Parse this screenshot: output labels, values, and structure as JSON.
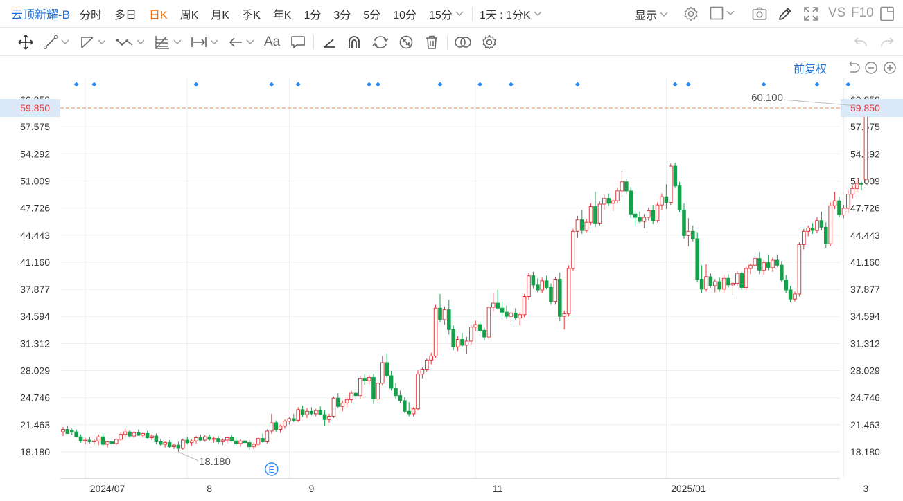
{
  "header": {
    "stock_name": "云顶新耀-B",
    "periods": [
      "分时",
      "多日",
      "日K",
      "周K",
      "月K",
      "季K",
      "年K",
      "1分",
      "3分",
      "5分",
      "10分",
      "15分"
    ],
    "active_period": "日K",
    "range_select": "1天 : 1分K",
    "display_label": "显示",
    "vs_label": "VS",
    "f10_label": "F10"
  },
  "toolbar": {
    "text_tool_label": "Aa",
    "icons": [
      "move-icon",
      "line-icon",
      "channel-icon",
      "polyline-icon",
      "fibonacci-icon",
      "measure-icon",
      "arrow-icon",
      "text-icon",
      "comment-icon",
      "angle-icon",
      "arc-icon",
      "cycle-icon",
      "hide-icon",
      "delete-icon",
      "compare-icon",
      "settings-icon",
      "undo-icon",
      "redo-icon"
    ]
  },
  "chart_controls": {
    "adjust_label": "前复权"
  },
  "colors": {
    "up": "#e0393e",
    "down": "#15a04b",
    "accent": "#1a6fd8",
    "price_line": "#f0874a",
    "current_price_bg": "#dce9f9",
    "current_price_text": "#e0393e",
    "event_marker": "#2d8cf0"
  },
  "chart_data": {
    "type": "candlestick",
    "y_ticks": [
      "60.858",
      "57.575",
      "54.292",
      "51.009",
      "47.726",
      "44.443",
      "41.160",
      "37.877",
      "34.594",
      "31.312",
      "28.029",
      "24.746",
      "21.463",
      "18.180"
    ],
    "ylim": [
      15.6,
      60.858
    ],
    "x_tick_labels": [
      {
        "label": "2024/07",
        "index": 5
      },
      {
        "label": "8",
        "index": 28
      },
      {
        "label": "9",
        "index": 51
      },
      {
        "label": "11",
        "index": 93
      },
      {
        "label": "2025/01",
        "index": 136
      },
      {
        "label": "3",
        "index": 176
      }
    ],
    "current_price": "59.850",
    "max_annotation": {
      "label": "60.100",
      "index": 179,
      "value": 60.1
    },
    "min_annotation": {
      "label": "18.180",
      "index": 26,
      "value": 18.18
    },
    "event_marker_label": "E",
    "event_marker_index": 47,
    "dividend_marker_indices": [
      3,
      7,
      30,
      47,
      53,
      69,
      71,
      85,
      94,
      101,
      116,
      138,
      141,
      158,
      170,
      177
    ],
    "ohlc": [
      [
        20.6,
        21.2,
        20.1,
        20.9
      ],
      [
        20.9,
        21.3,
        20.5,
        20.4
      ],
      [
        20.8,
        21.0,
        20.2,
        20.6
      ],
      [
        20.6,
        20.9,
        19.9,
        20.0
      ],
      [
        20.0,
        20.3,
        19.3,
        19.5
      ],
      [
        19.5,
        19.9,
        19.1,
        19.6
      ],
      [
        19.6,
        20.0,
        19.2,
        19.4
      ],
      [
        19.4,
        19.8,
        19.0,
        19.5
      ],
      [
        19.5,
        20.3,
        19.0,
        20.0
      ],
      [
        20.0,
        20.4,
        18.9,
        19.1
      ],
      [
        19.1,
        19.5,
        18.7,
        19.4
      ],
      [
        19.4,
        19.7,
        18.9,
        19.2
      ],
      [
        19.2,
        19.8,
        19.0,
        19.7
      ],
      [
        19.7,
        20.5,
        19.5,
        20.3
      ],
      [
        20.3,
        21.0,
        20.0,
        20.6
      ],
      [
        20.6,
        20.8,
        19.9,
        20.1
      ],
      [
        20.1,
        20.7,
        19.9,
        20.5
      ],
      [
        20.5,
        20.9,
        20.1,
        20.2
      ],
      [
        20.2,
        20.6,
        19.9,
        20.4
      ],
      [
        20.4,
        20.7,
        19.8,
        19.9
      ],
      [
        19.9,
        20.3,
        19.6,
        20.1
      ],
      [
        20.1,
        20.4,
        19.1,
        19.4
      ],
      [
        19.4,
        19.8,
        18.9,
        19.1
      ],
      [
        19.1,
        19.5,
        18.7,
        19.3
      ],
      [
        19.3,
        19.6,
        18.6,
        18.8
      ],
      [
        18.8,
        19.2,
        18.5,
        19.0
      ],
      [
        19.0,
        19.4,
        18.2,
        18.6
      ],
      [
        18.6,
        19.8,
        18.4,
        19.6
      ],
      [
        19.6,
        20.0,
        19.1,
        19.3
      ],
      [
        19.3,
        19.7,
        18.9,
        19.5
      ],
      [
        19.5,
        20.1,
        19.2,
        19.9
      ],
      [
        19.9,
        20.3,
        19.5,
        19.6
      ],
      [
        19.6,
        20.2,
        19.4,
        20.0
      ],
      [
        20.0,
        20.3,
        19.5,
        19.7
      ],
      [
        19.7,
        20.0,
        19.3,
        19.8
      ],
      [
        19.8,
        20.1,
        19.1,
        19.4
      ],
      [
        19.4,
        19.8,
        19.0,
        19.6
      ],
      [
        19.6,
        20.0,
        19.2,
        19.9
      ],
      [
        19.9,
        20.2,
        19.4,
        19.5
      ],
      [
        19.5,
        19.9,
        18.9,
        19.2
      ],
      [
        19.2,
        19.7,
        18.8,
        19.5
      ],
      [
        19.5,
        19.8,
        19.1,
        19.3
      ],
      [
        19.3,
        19.6,
        18.4,
        18.8
      ],
      [
        18.8,
        19.3,
        18.5,
        19.1
      ],
      [
        19.1,
        19.9,
        18.9,
        19.8
      ],
      [
        19.8,
        20.4,
        19.3,
        19.4
      ],
      [
        19.4,
        20.9,
        19.2,
        20.7
      ],
      [
        20.7,
        22.8,
        20.4,
        21.7
      ],
      [
        21.7,
        22.0,
        20.6,
        20.9
      ],
      [
        20.9,
        21.5,
        20.5,
        21.3
      ],
      [
        21.3,
        22.1,
        21.0,
        21.9
      ],
      [
        21.9,
        22.4,
        21.5,
        22.2
      ],
      [
        22.2,
        22.8,
        21.8,
        22.0
      ],
      [
        22.0,
        23.6,
        21.8,
        23.3
      ],
      [
        23.3,
        23.8,
        22.4,
        22.7
      ],
      [
        22.7,
        23.5,
        22.3,
        23.1
      ],
      [
        23.1,
        23.6,
        22.6,
        22.8
      ],
      [
        22.8,
        23.4,
        22.5,
        23.2
      ],
      [
        23.2,
        23.7,
        22.6,
        22.7
      ],
      [
        22.7,
        23.3,
        21.3,
        22.1
      ],
      [
        22.1,
        22.8,
        21.7,
        22.5
      ],
      [
        22.5,
        24.9,
        22.3,
        24.7
      ],
      [
        24.7,
        25.3,
        23.5,
        23.7
      ],
      [
        23.7,
        24.4,
        23.1,
        24.1
      ],
      [
        24.1,
        24.8,
        23.6,
        24.5
      ],
      [
        24.5,
        25.6,
        24.1,
        25.3
      ],
      [
        25.3,
        25.8,
        24.6,
        25.0
      ],
      [
        25.0,
        27.4,
        24.6,
        27.1
      ],
      [
        27.1,
        27.6,
        26.3,
        26.8
      ],
      [
        26.8,
        27.5,
        26.4,
        27.2
      ],
      [
        27.2,
        27.6,
        24.0,
        24.6
      ],
      [
        24.6,
        26.9,
        24.1,
        26.5
      ],
      [
        26.5,
        29.8,
        26.2,
        29.0
      ],
      [
        29.0,
        30.1,
        27.2,
        27.4
      ],
      [
        27.4,
        28.0,
        25.6,
        25.9
      ],
      [
        25.9,
        26.5,
        24.6,
        25.0
      ],
      [
        25.0,
        25.6,
        24.1,
        24.4
      ],
      [
        24.4,
        24.8,
        22.9,
        23.1
      ],
      [
        23.1,
        24.2,
        22.5,
        22.8
      ],
      [
        22.8,
        23.6,
        22.5,
        23.4
      ],
      [
        23.4,
        28.1,
        23.2,
        27.6
      ],
      [
        27.6,
        28.4,
        27.1,
        28.2
      ],
      [
        28.2,
        29.5,
        27.9,
        29.3
      ],
      [
        29.3,
        30.2,
        28.8,
        29.8
      ],
      [
        29.8,
        36.0,
        29.6,
        35.6
      ],
      [
        35.6,
        37.3,
        33.9,
        34.2
      ],
      [
        34.2,
        35.8,
        33.6,
        35.4
      ],
      [
        35.4,
        36.6,
        32.4,
        33.0
      ],
      [
        33.0,
        33.5,
        30.5,
        30.9
      ],
      [
        30.9,
        32.2,
        30.4,
        31.8
      ],
      [
        31.8,
        32.6,
        30.9,
        31.1
      ],
      [
        31.1,
        32.1,
        30.0,
        31.6
      ],
      [
        31.6,
        33.6,
        31.2,
        33.3
      ],
      [
        33.3,
        34.1,
        32.8,
        33.6
      ],
      [
        33.6,
        33.9,
        32.6,
        32.9
      ],
      [
        32.9,
        33.2,
        31.7,
        32.1
      ],
      [
        32.1,
        35.9,
        31.8,
        35.7
      ],
      [
        35.7,
        37.4,
        35.2,
        36.2
      ],
      [
        36.2,
        37.8,
        35.4,
        35.6
      ],
      [
        35.6,
        36.4,
        34.6,
        35.1
      ],
      [
        35.1,
        35.9,
        34.3,
        34.6
      ],
      [
        34.6,
        35.3,
        33.9,
        35.0
      ],
      [
        35.0,
        35.6,
        34.2,
        34.4
      ],
      [
        34.4,
        35.1,
        33.5,
        34.8
      ],
      [
        34.8,
        37.3,
        34.5,
        37.0
      ],
      [
        37.0,
        39.9,
        36.6,
        39.5
      ],
      [
        39.5,
        40.0,
        38.0,
        38.4
      ],
      [
        38.4,
        39.2,
        37.5,
        37.8
      ],
      [
        37.8,
        39.3,
        37.4,
        38.9
      ],
      [
        38.9,
        39.5,
        37.9,
        38.1
      ],
      [
        38.1,
        38.6,
        36.0,
        36.4
      ],
      [
        36.4,
        39.4,
        36.0,
        39.1
      ],
      [
        39.1,
        39.9,
        34.0,
        34.6
      ],
      [
        34.6,
        35.3,
        33.0,
        34.9
      ],
      [
        34.9,
        40.8,
        34.6,
        40.4
      ],
      [
        40.4,
        45.2,
        40.1,
        44.9
      ],
      [
        44.9,
        46.8,
        44.1,
        46.3
      ],
      [
        46.3,
        47.5,
        44.6,
        45.0
      ],
      [
        45.0,
        46.4,
        44.8,
        46.0
      ],
      [
        46.0,
        48.3,
        45.7,
        47.9
      ],
      [
        47.9,
        49.7,
        45.4,
        45.9
      ],
      [
        45.9,
        48.5,
        45.6,
        48.2
      ],
      [
        48.2,
        49.4,
        47.5,
        48.9
      ],
      [
        48.9,
        49.5,
        48.0,
        48.3
      ],
      [
        48.3,
        48.9,
        47.4,
        48.6
      ],
      [
        48.6,
        50.2,
        48.3,
        49.8
      ],
      [
        49.8,
        52.2,
        49.1,
        50.9
      ],
      [
        50.9,
        51.3,
        49.4,
        49.8
      ],
      [
        49.8,
        50.3,
        46.5,
        47.0
      ],
      [
        47.0,
        47.4,
        45.6,
        46.6
      ],
      [
        46.6,
        47.3,
        45.9,
        46.1
      ],
      [
        46.1,
        47.0,
        45.3,
        46.6
      ],
      [
        46.6,
        47.8,
        46.2,
        47.4
      ],
      [
        47.4,
        48.1,
        45.8,
        46.2
      ],
      [
        46.2,
        48.4,
        46.0,
        48.1
      ],
      [
        48.1,
        49.5,
        47.5,
        49.1
      ],
      [
        49.1,
        50.6,
        47.6,
        48.4
      ],
      [
        48.4,
        53.1,
        48.1,
        52.8
      ],
      [
        52.8,
        53.2,
        50.1,
        50.4
      ],
      [
        50.4,
        50.9,
        47.2,
        47.5
      ],
      [
        47.5,
        48.3,
        44.0,
        44.4
      ],
      [
        44.4,
        46.5,
        43.1,
        44.9
      ],
      [
        44.9,
        45.6,
        43.7,
        44.0
      ],
      [
        44.0,
        44.8,
        38.7,
        39.1
      ],
      [
        39.1,
        40.8,
        37.4,
        37.9
      ],
      [
        37.9,
        40.9,
        37.6,
        39.4
      ],
      [
        39.4,
        39.8,
        38.1,
        38.3
      ],
      [
        38.3,
        39.1,
        37.5,
        38.8
      ],
      [
        38.8,
        39.3,
        37.6,
        37.9
      ],
      [
        37.9,
        39.6,
        37.4,
        39.2
      ],
      [
        39.2,
        39.7,
        38.1,
        38.4
      ],
      [
        38.4,
        38.8,
        37.1,
        38.6
      ],
      [
        38.6,
        40.1,
        38.2,
        39.8
      ],
      [
        39.8,
        40.0,
        37.8,
        38.1
      ],
      [
        38.1,
        40.6,
        37.8,
        40.4
      ],
      [
        40.4,
        41.0,
        39.7,
        40.8
      ],
      [
        40.8,
        41.9,
        40.3,
        41.6
      ],
      [
        41.6,
        42.4,
        39.7,
        40.2
      ],
      [
        40.2,
        41.4,
        39.6,
        41.1
      ],
      [
        41.1,
        42.1,
        40.2,
        40.5
      ],
      [
        40.5,
        41.7,
        40.0,
        41.4
      ],
      [
        41.4,
        42.1,
        40.6,
        40.8
      ],
      [
        40.8,
        41.3,
        38.7,
        39.0
      ],
      [
        39.0,
        39.6,
        37.4,
        37.8
      ],
      [
        37.8,
        38.3,
        36.3,
        36.7
      ],
      [
        36.7,
        37.6,
        36.4,
        37.3
      ],
      [
        37.3,
        43.6,
        37.0,
        43.3
      ],
      [
        43.3,
        45.2,
        42.7,
        44.9
      ],
      [
        44.9,
        45.6,
        44.3,
        45.3
      ],
      [
        45.3,
        45.9,
        44.6,
        45.0
      ],
      [
        45.0,
        46.6,
        44.7,
        46.2
      ],
      [
        46.2,
        47.3,
        45.0,
        45.4
      ],
      [
        45.4,
        46.0,
        42.9,
        43.4
      ],
      [
        43.4,
        48.4,
        43.1,
        48.0
      ],
      [
        48.0,
        49.7,
        47.6,
        48.6
      ],
      [
        48.6,
        49.1,
        46.6,
        46.9
      ],
      [
        46.9,
        48.1,
        46.5,
        47.7
      ],
      [
        47.7,
        49.9,
        47.1,
        49.4
      ],
      [
        49.4,
        50.4,
        48.9,
        50.1
      ],
      [
        50.1,
        51.3,
        49.7,
        50.7
      ],
      [
        50.7,
        50.9,
        49.9,
        50.6
      ],
      [
        51.2,
        60.1,
        51.0,
        59.85
      ]
    ]
  }
}
